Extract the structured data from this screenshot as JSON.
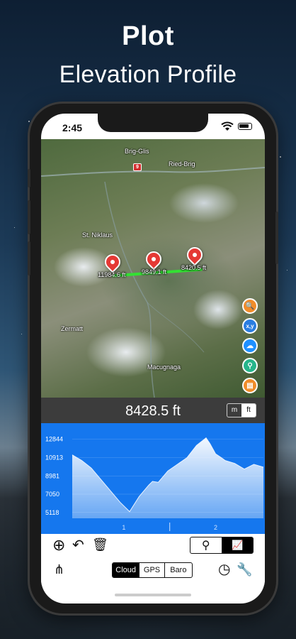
{
  "marketing": {
    "title": "Plot",
    "subtitle": "Elevation Profile"
  },
  "status_bar": {
    "time": "2:45"
  },
  "map": {
    "labels": {
      "brig_glis": "Brig-Glis",
      "ried_brig": "Ried-Brig",
      "st_niklaus": "St. Niklaus",
      "zermatt": "Zermatt",
      "macugnaga": "Macugnaga"
    },
    "road_badge": "9",
    "pins": [
      {
        "label": "11984.6 ft"
      },
      {
        "label": "9849.1 ft"
      },
      {
        "label": "8420.5 ft"
      }
    ],
    "buttons": {
      "search": "🔍",
      "xy": "x,y",
      "layers": "☁",
      "location": "⚲",
      "map": "▤"
    }
  },
  "readout": {
    "value": "8428.5 ft",
    "unit_m": "m",
    "unit_ft": "ft",
    "selected_unit": "ft"
  },
  "chart_data": {
    "type": "area",
    "y_ticks": [
      "12844",
      "10913",
      "8981",
      "7050",
      "5118"
    ],
    "x_ticks": [
      "1",
      "2"
    ],
    "ylim": [
      4500,
      13500
    ],
    "x": [
      0,
      0.05,
      0.1,
      0.15,
      0.2,
      0.25,
      0.3,
      0.35,
      0.4,
      0.42,
      0.45,
      0.5,
      0.55,
      0.6,
      0.65,
      0.7,
      0.72,
      0.75,
      0.78,
      0.8,
      0.85,
      0.9,
      0.95,
      1.0
    ],
    "values": [
      11200,
      10600,
      9800,
      8600,
      7400,
      6200,
      5200,
      6800,
      8000,
      8400,
      8300,
      9500,
      10200,
      10900,
      12200,
      13000,
      12400,
      11300,
      10900,
      10600,
      10300,
      9700,
      10200,
      9900
    ],
    "fill_color": "#ffffff",
    "background_color": "#1577ee"
  },
  "toolbar": {
    "add_icon": "⊕",
    "undo_icon": "↶",
    "trash_icon": "🗑",
    "view_pin": "⚲",
    "view_chart": "📈",
    "share_icon": "⋔",
    "source_options": [
      "Cloud",
      "GPS",
      "Baro"
    ],
    "selected_source": "Cloud",
    "gauge_icon": "◷",
    "wrench_icon": "🔧"
  }
}
